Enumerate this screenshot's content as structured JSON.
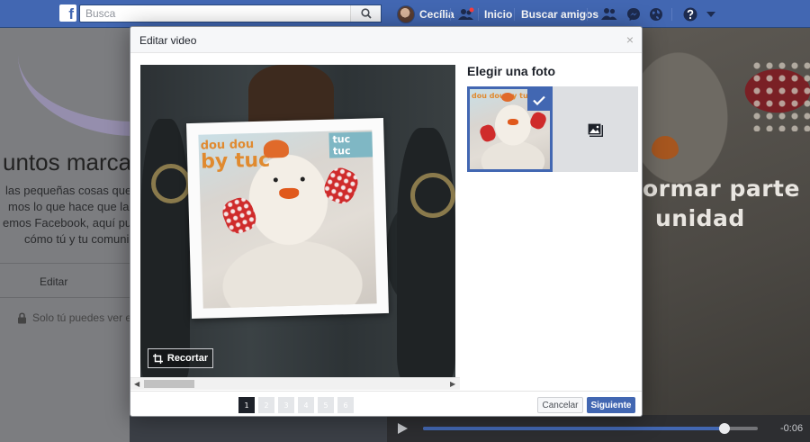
{
  "topbar": {
    "logo_letter": "f",
    "search_placeholder": "Busca",
    "user_name": "Cecília",
    "nav_home": "Inicio",
    "nav_find_friends": "Buscar amigos"
  },
  "background_page": {
    "title": "untos marcan",
    "lines": [
      "las pequeñas cosas que",
      "mos lo que hace que la c",
      "emos Facebook, aquí pued",
      "cómo tú y tu comuni"
    ],
    "edit_label": "Editar",
    "privacy_label": "Solo tú puedes ver es"
  },
  "background_video": {
    "text_line1": "ormar parte",
    "text_line2": "unidad",
    "time": "-0:06",
    "progress_fraction": 0.9
  },
  "modal": {
    "title": "Editar video",
    "close_label": "×",
    "crop_label": "Recortar",
    "choose_photo_title": "Elegir una foto",
    "photo_brand_top": "dou dou",
    "photo_brand_bottom": "by tuc",
    "photo_brand_small": "tuc tuc",
    "thumb_brand": "dou dou by tuc",
    "pages": [
      "1",
      "2",
      "3",
      "4",
      "5",
      "6"
    ],
    "active_page": "1",
    "cancel_label": "Cancelar",
    "next_label": "Siguiente"
  },
  "colors": {
    "brand_blue": "#4267b2",
    "header_blue": "#29487d"
  }
}
